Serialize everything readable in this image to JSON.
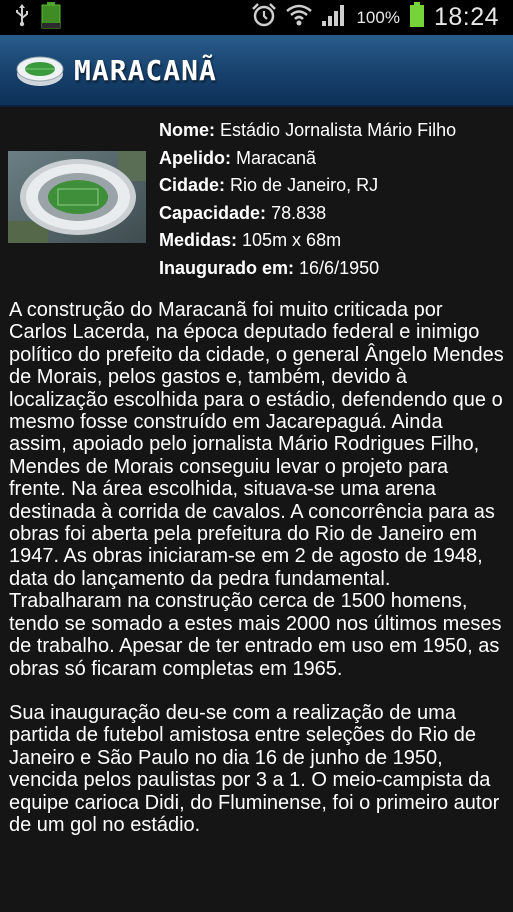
{
  "status_bar": {
    "battery_percent": "100%",
    "time": "18:24",
    "icons": [
      "usb-icon",
      "battery-small-icon",
      "alarm-icon",
      "wifi-icon",
      "signal-icon",
      "battery-icon"
    ]
  },
  "header": {
    "title": "MARACANÃ",
    "icon": "stadium-icon",
    "color": "#1f4d7a"
  },
  "info": {
    "fields": [
      {
        "label": "Nome:",
        "value": "Estádio Jornalista Mário Filho"
      },
      {
        "label": "Apelido:",
        "value": "Maracanã"
      },
      {
        "label": "Cidade:",
        "value": "Rio de Janeiro, RJ"
      },
      {
        "label": "Capacidade:",
        "value": "78.838"
      },
      {
        "label": "Medidas:",
        "value": "105m x 68m"
      },
      {
        "label": "Inaugurado em:",
        "value": "16/6/1950"
      }
    ]
  },
  "description": {
    "paragraphs": [
      "A construção do Maracanã foi muito criticada por Carlos Lacerda, na época deputado federal e inimigo político do prefeito da cidade, o general Ângelo Mendes de Morais, pelos gastos e, também, devido à localização escolhida para o estádio, defendendo que o mesmo fosse construído em Jacarepaguá. Ainda assim, apoiado pelo jornalista Mário Rodrigues Filho, Mendes de Morais conseguiu levar o projeto para frente. Na área escolhida, situava-se uma arena destinada à corrida de cavalos. A concorrência para as obras foi aberta pela prefeitura do Rio de Janeiro em 1947. As obras iniciaram-se em 2 de agosto de 1948, data do lançamento da pedra fundamental. Trabalharam na construção cerca de 1500 homens, tendo se somado a estes mais 2000 nos últimos meses de trabalho. Apesar de ter entrado em uso em 1950, as obras só ficaram completas em 1965.",
      "Sua inauguração deu-se com a realização de uma partida de futebol amistosa entre seleções do Rio de Janeiro e São Paulo no dia 16 de junho de 1950, vencida pelos paulistas por 3 a 1. O meio-campista da equipe carioca Didi, do Fluminense, foi o primeiro autor de um gol no estádio."
    ]
  }
}
